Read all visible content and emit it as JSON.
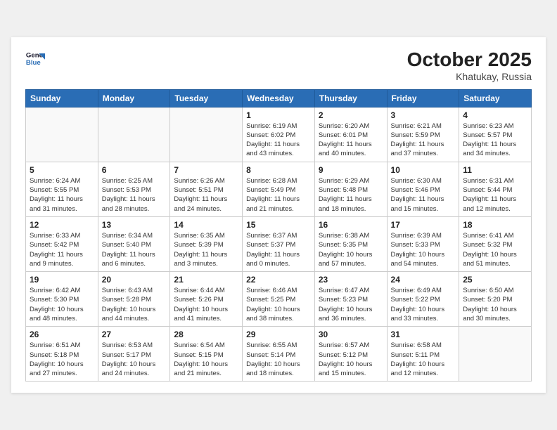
{
  "header": {
    "logo_line1": "General",
    "logo_line2": "Blue",
    "title": "October 2025",
    "location": "Khatukay, Russia"
  },
  "weekdays": [
    "Sunday",
    "Monday",
    "Tuesday",
    "Wednesday",
    "Thursday",
    "Friday",
    "Saturday"
  ],
  "weeks": [
    [
      {
        "day": "",
        "info": ""
      },
      {
        "day": "",
        "info": ""
      },
      {
        "day": "",
        "info": ""
      },
      {
        "day": "1",
        "info": "Sunrise: 6:19 AM\nSunset: 6:02 PM\nDaylight: 11 hours\nand 43 minutes."
      },
      {
        "day": "2",
        "info": "Sunrise: 6:20 AM\nSunset: 6:01 PM\nDaylight: 11 hours\nand 40 minutes."
      },
      {
        "day": "3",
        "info": "Sunrise: 6:21 AM\nSunset: 5:59 PM\nDaylight: 11 hours\nand 37 minutes."
      },
      {
        "day": "4",
        "info": "Sunrise: 6:23 AM\nSunset: 5:57 PM\nDaylight: 11 hours\nand 34 minutes."
      }
    ],
    [
      {
        "day": "5",
        "info": "Sunrise: 6:24 AM\nSunset: 5:55 PM\nDaylight: 11 hours\nand 31 minutes."
      },
      {
        "day": "6",
        "info": "Sunrise: 6:25 AM\nSunset: 5:53 PM\nDaylight: 11 hours\nand 28 minutes."
      },
      {
        "day": "7",
        "info": "Sunrise: 6:26 AM\nSunset: 5:51 PM\nDaylight: 11 hours\nand 24 minutes."
      },
      {
        "day": "8",
        "info": "Sunrise: 6:28 AM\nSunset: 5:49 PM\nDaylight: 11 hours\nand 21 minutes."
      },
      {
        "day": "9",
        "info": "Sunrise: 6:29 AM\nSunset: 5:48 PM\nDaylight: 11 hours\nand 18 minutes."
      },
      {
        "day": "10",
        "info": "Sunrise: 6:30 AM\nSunset: 5:46 PM\nDaylight: 11 hours\nand 15 minutes."
      },
      {
        "day": "11",
        "info": "Sunrise: 6:31 AM\nSunset: 5:44 PM\nDaylight: 11 hours\nand 12 minutes."
      }
    ],
    [
      {
        "day": "12",
        "info": "Sunrise: 6:33 AM\nSunset: 5:42 PM\nDaylight: 11 hours\nand 9 minutes."
      },
      {
        "day": "13",
        "info": "Sunrise: 6:34 AM\nSunset: 5:40 PM\nDaylight: 11 hours\nand 6 minutes."
      },
      {
        "day": "14",
        "info": "Sunrise: 6:35 AM\nSunset: 5:39 PM\nDaylight: 11 hours\nand 3 minutes."
      },
      {
        "day": "15",
        "info": "Sunrise: 6:37 AM\nSunset: 5:37 PM\nDaylight: 11 hours\nand 0 minutes."
      },
      {
        "day": "16",
        "info": "Sunrise: 6:38 AM\nSunset: 5:35 PM\nDaylight: 10 hours\nand 57 minutes."
      },
      {
        "day": "17",
        "info": "Sunrise: 6:39 AM\nSunset: 5:33 PM\nDaylight: 10 hours\nand 54 minutes."
      },
      {
        "day": "18",
        "info": "Sunrise: 6:41 AM\nSunset: 5:32 PM\nDaylight: 10 hours\nand 51 minutes."
      }
    ],
    [
      {
        "day": "19",
        "info": "Sunrise: 6:42 AM\nSunset: 5:30 PM\nDaylight: 10 hours\nand 48 minutes."
      },
      {
        "day": "20",
        "info": "Sunrise: 6:43 AM\nSunset: 5:28 PM\nDaylight: 10 hours\nand 44 minutes."
      },
      {
        "day": "21",
        "info": "Sunrise: 6:44 AM\nSunset: 5:26 PM\nDaylight: 10 hours\nand 41 minutes."
      },
      {
        "day": "22",
        "info": "Sunrise: 6:46 AM\nSunset: 5:25 PM\nDaylight: 10 hours\nand 38 minutes."
      },
      {
        "day": "23",
        "info": "Sunrise: 6:47 AM\nSunset: 5:23 PM\nDaylight: 10 hours\nand 36 minutes."
      },
      {
        "day": "24",
        "info": "Sunrise: 6:49 AM\nSunset: 5:22 PM\nDaylight: 10 hours\nand 33 minutes."
      },
      {
        "day": "25",
        "info": "Sunrise: 6:50 AM\nSunset: 5:20 PM\nDaylight: 10 hours\nand 30 minutes."
      }
    ],
    [
      {
        "day": "26",
        "info": "Sunrise: 6:51 AM\nSunset: 5:18 PM\nDaylight: 10 hours\nand 27 minutes."
      },
      {
        "day": "27",
        "info": "Sunrise: 6:53 AM\nSunset: 5:17 PM\nDaylight: 10 hours\nand 24 minutes."
      },
      {
        "day": "28",
        "info": "Sunrise: 6:54 AM\nSunset: 5:15 PM\nDaylight: 10 hours\nand 21 minutes."
      },
      {
        "day": "29",
        "info": "Sunrise: 6:55 AM\nSunset: 5:14 PM\nDaylight: 10 hours\nand 18 minutes."
      },
      {
        "day": "30",
        "info": "Sunrise: 6:57 AM\nSunset: 5:12 PM\nDaylight: 10 hours\nand 15 minutes."
      },
      {
        "day": "31",
        "info": "Sunrise: 6:58 AM\nSunset: 5:11 PM\nDaylight: 10 hours\nand 12 minutes."
      },
      {
        "day": "",
        "info": ""
      }
    ]
  ]
}
